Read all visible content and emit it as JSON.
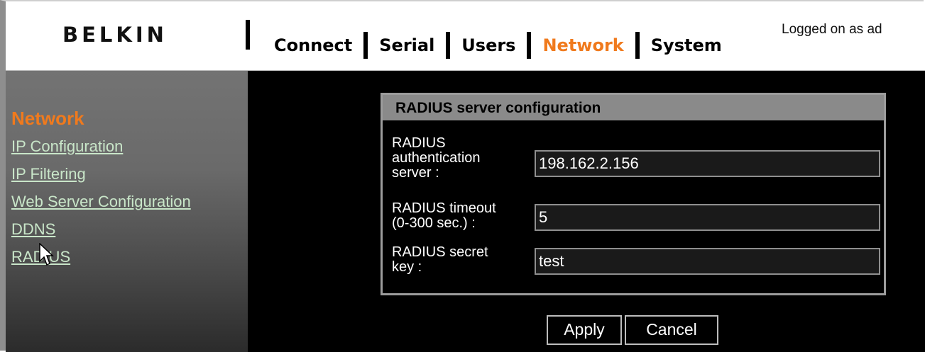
{
  "header": {
    "logo": "BELKIN",
    "nav": [
      {
        "label": "Connect",
        "active": false
      },
      {
        "label": "Serial",
        "active": false
      },
      {
        "label": "Users",
        "active": false
      },
      {
        "label": "Network",
        "active": true
      },
      {
        "label": "System",
        "active": false
      }
    ],
    "logged_text": "Logged on as ad"
  },
  "sidebar": {
    "title": "Network",
    "items": [
      {
        "label": "IP Configuration"
      },
      {
        "label": "IP Filtering"
      },
      {
        "label": "Web Server Configuration"
      },
      {
        "label": "DDNS"
      },
      {
        "label": "RADIUS"
      }
    ]
  },
  "panel": {
    "title": "RADIUS server configuration",
    "fields": [
      {
        "label_lines": [
          "RADIUS",
          "authentication",
          "server :"
        ],
        "value": "198.162.2.156"
      },
      {
        "label_lines": [
          "RADIUS timeout",
          "(0-300 sec.) :"
        ],
        "value": "5"
      },
      {
        "label_lines": [
          "RADIUS secret",
          "key :"
        ],
        "value": "test"
      }
    ]
  },
  "buttons": {
    "apply": "Apply",
    "cancel": "Cancel"
  },
  "colors": {
    "accent": "#f07a1d",
    "link": "#c9e6c9",
    "main_bg": "#000000"
  }
}
